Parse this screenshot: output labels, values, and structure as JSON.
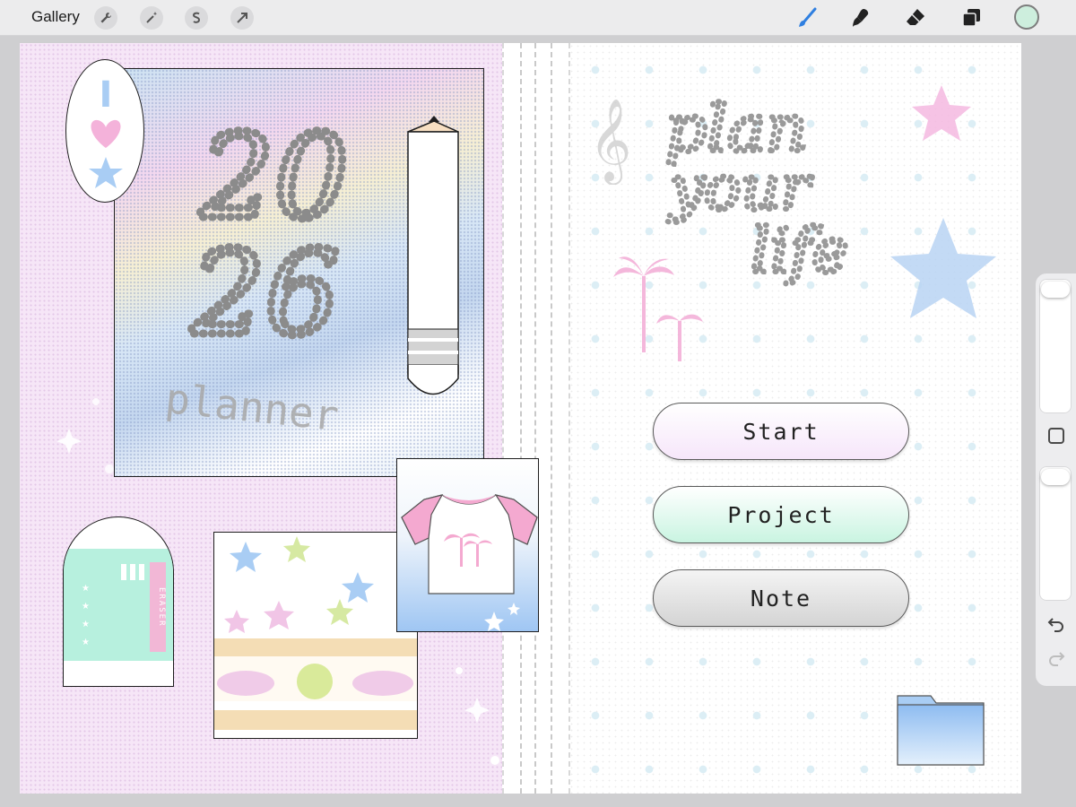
{
  "app": {
    "gallery_label": "Gallery",
    "tools_left": [
      {
        "icon": "wrench-icon",
        "name": "actions"
      },
      {
        "icon": "magic-wand-icon",
        "name": "adjustments"
      },
      {
        "icon": "selection-icon",
        "name": "selection"
      },
      {
        "icon": "transform-arrow-icon",
        "name": "transform"
      }
    ],
    "tools_right": [
      {
        "icon": "brush-icon",
        "name": "paint",
        "active": true
      },
      {
        "icon": "smudge-icon",
        "name": "smudge"
      },
      {
        "icon": "eraser-icon",
        "name": "erase"
      },
      {
        "icon": "layers-icon",
        "name": "layers"
      }
    ],
    "current_color": "#cdeedd",
    "accent_color": "#2f7fe0"
  },
  "canvas": {
    "cover": {
      "year_top": "20",
      "year_bottom": "26",
      "subtitle": "planner"
    },
    "oval_badge": {
      "letter": "I"
    },
    "eraser_sticker": {
      "label": "ERASER"
    },
    "title_script": {
      "line1": "plan",
      "line2": "your",
      "line3": "life"
    },
    "menu": {
      "start": "Start",
      "project": "Project",
      "note": "Note"
    }
  },
  "colors": {
    "left_page": "#f6e6f7",
    "start_gradient": "#f6e6fa",
    "project_gradient": "#c9f4e1",
    "note_gradient": "#d4d4d4",
    "folder": "#a9cdf4"
  }
}
